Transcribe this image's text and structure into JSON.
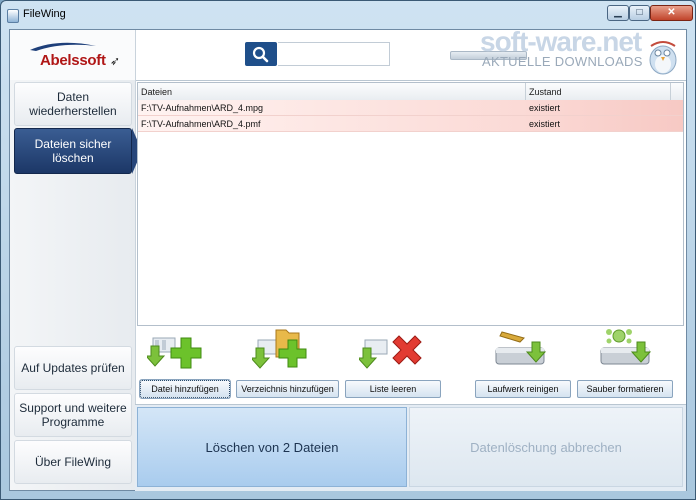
{
  "window": {
    "title": "FileWing"
  },
  "header": {
    "logo_text": "Abelssoft",
    "search_placeholder": "",
    "watermark": {
      "title": "soft-ware.net",
      "subtitle": "AKTUELLE DOWNLOADS"
    }
  },
  "sidebar": {
    "items": [
      {
        "label": "Daten wiederherstellen",
        "active": false
      },
      {
        "label": "Dateien sicher löschen",
        "active": true
      },
      {
        "label": "Auf Updates prüfen",
        "active": false
      },
      {
        "label": "Support und weitere Programme",
        "active": false
      },
      {
        "label": "Über FileWing",
        "active": false
      }
    ]
  },
  "table": {
    "columns": [
      "Dateien",
      "Zustand"
    ],
    "rows": [
      {
        "file": "F:\\TV-Aufnahmen\\ARD_4.mpg",
        "state": "existiert"
      },
      {
        "file": "F:\\TV-Aufnahmen\\ARD_4.pmf",
        "state": "existiert"
      }
    ]
  },
  "actions": {
    "add_file": "Datei hinzufügen",
    "add_dir": "Verzeichnis hinzufügen",
    "clear_list": "Liste leeren",
    "clean_drive": "Laufwerk reinigen",
    "clean_format": "Sauber formatieren"
  },
  "bottom": {
    "delete_label": "Löschen von 2 Dateien",
    "cancel_label": "Datenlöschung abbrechen"
  },
  "colors": {
    "active_nav": "#1c3767",
    "row_highlight": "#f7c9c4",
    "logo_red": "#b01616"
  }
}
